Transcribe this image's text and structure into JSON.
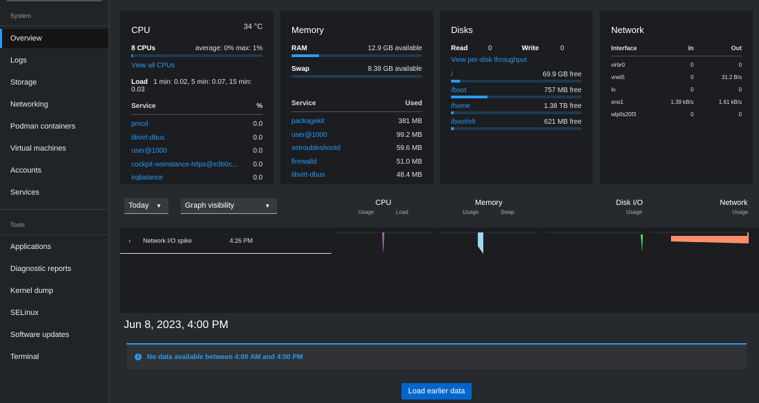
{
  "sidebar": {
    "system_label": "System",
    "tools_label": "Tools",
    "system_items": [
      "Overview",
      "Logs",
      "Storage",
      "Networking",
      "Podman containers",
      "Virtual machines",
      "Accounts",
      "Services"
    ],
    "tools_items": [
      "Applications",
      "Diagnostic reports",
      "Kernel dump",
      "SELinux",
      "Software updates",
      "Terminal"
    ],
    "active": "Overview"
  },
  "cpu": {
    "title": "CPU",
    "temp": "34 °C",
    "count": "8 CPUs",
    "avg": "average: 0% max: 1%",
    "usage_percent": 1,
    "view_all": "View all CPUs",
    "load_label": "Load",
    "load": "1 min: 0.02, 5 min: 0.07, 15 min: 0.03",
    "col_service": "Service",
    "col_pct": "%",
    "rows": [
      [
        "pmcd",
        "0.0"
      ],
      [
        "libvirt-dbus",
        "0.0"
      ],
      [
        "user@1000",
        "0.0"
      ],
      [
        "cockpit-wsinstance-https@e3b0c...",
        "0.0"
      ],
      [
        "irqbalance",
        "0.0"
      ]
    ]
  },
  "memory": {
    "title": "Memory",
    "ram_label": "RAM",
    "ram": "12.9 GB available",
    "ram_used_percent": 21,
    "swap_label": "Swap",
    "swap": "8.38 GB available",
    "swap_used_percent": 0,
    "col_service": "Service",
    "col_used": "Used",
    "rows": [
      [
        "packagekit",
        "381 MB"
      ],
      [
        "user@1000",
        "99.2 MB"
      ],
      [
        "setroubleshootd",
        "59.6 MB"
      ],
      [
        "firewalld",
        "51.0 MB"
      ],
      [
        "libvirt-dbus",
        "48.4 MB"
      ]
    ]
  },
  "disks": {
    "title": "Disks",
    "read_label": "Read",
    "read": "0",
    "write_label": "Write",
    "write": "0",
    "view_link": "View per-disk throughput",
    "mounts": [
      {
        "name": "/",
        "free": "69.9 GB free",
        "used_percent": 7
      },
      {
        "name": "/boot",
        "free": "757 MB free",
        "used_percent": 28
      },
      {
        "name": "/home",
        "free": "1.38 TB free",
        "used_percent": 2
      },
      {
        "name": "/boot/efi",
        "free": "621 MB free",
        "used_percent": 2
      }
    ]
  },
  "network": {
    "title": "Network",
    "col_iface": "Interface",
    "col_in": "In",
    "col_out": "Out",
    "rows": [
      [
        "virbr0",
        "0",
        "0"
      ],
      [
        "vnet5",
        "0",
        "31.2 B/s"
      ],
      [
        "lo",
        "0",
        "0"
      ],
      [
        "eno1",
        "1.39 kB/s",
        "1.61 kB/s"
      ],
      [
        "wlp0s20f3",
        "0",
        "0"
      ]
    ]
  },
  "timeline": {
    "range": "Today",
    "graph_visibility": "Graph visibility",
    "groups": [
      {
        "title": "CPU",
        "subs": [
          "Usage",
          "Load"
        ]
      },
      {
        "title": "Memory",
        "subs": [
          "Usage",
          "Swap"
        ]
      },
      {
        "title": "Disk I/O",
        "subs": [
          "Usage"
        ]
      },
      {
        "title": "Network",
        "subs": [
          "Usage"
        ]
      }
    ],
    "event": {
      "label": "Network I/O spike",
      "time": "4:26 PM"
    },
    "colors": {
      "cpu": "#a66fb5",
      "memory": "#9fd8ee",
      "disk": "#6ee07a",
      "network": "#ff8f6b"
    }
  },
  "history": {
    "date": "Jun 8, 2023, 4:00 PM",
    "alert": "No data available between 4:00 AM and 4:00 PM",
    "load_button": "Load earlier data"
  }
}
